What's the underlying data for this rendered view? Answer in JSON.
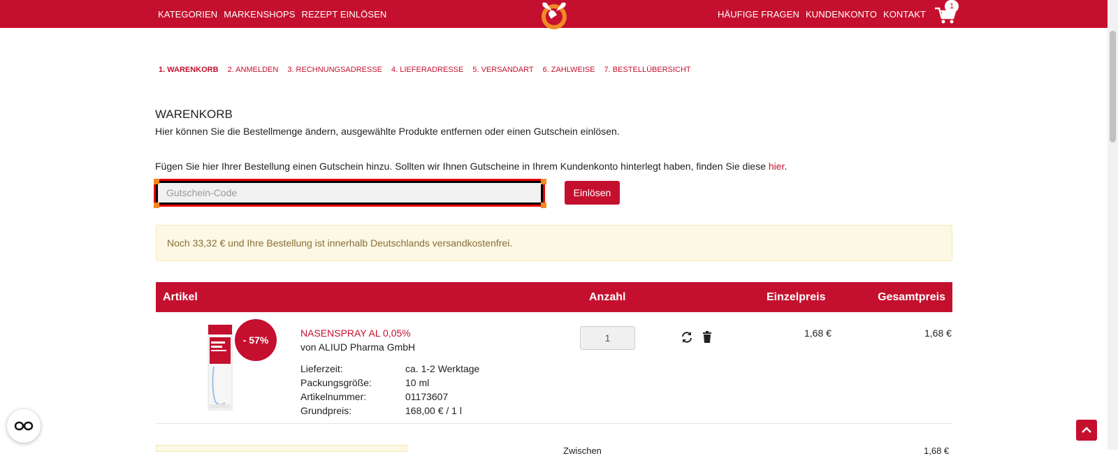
{
  "header": {
    "nav_left": [
      "KATEGORIEN",
      "MARKENSHOPS",
      "REZEPT EINLÖSEN"
    ],
    "nav_right": [
      "HÄUFIGE FRAGEN",
      "KUNDENKONTO",
      "KONTAKT"
    ],
    "cart_count": "1",
    "logo_icon": "pharmacy-logo-icon",
    "cart_icon": "cart-icon"
  },
  "steps": [
    "1. WARENKORB",
    "2. ANMELDEN",
    "3. RECHNUNGSADRESSE",
    "4. LIEFERADRESSE",
    "5. VERSANDART",
    "6. ZAHLWEISE",
    "7. BESTELLÜBERSICHT"
  ],
  "cart": {
    "title": "WARENKORB",
    "description": "Hier können Sie die Bestellmenge ändern, ausgewählte Produkte entfernen oder einen Gutschein einlösen.",
    "coupon_text": "Fügen Sie hier Ihrer Bestellung einen Gutschein hinzu. Sollten wir Ihnen Gutscheine in Ihrem Kundenkonto hinterlegt haben, finden Sie diese",
    "coupon_link": "hier",
    "coupon_suffix": ".",
    "coupon_placeholder": "Gutschein-Code",
    "redeem_label": "Einlösen",
    "notice": "Noch 33,32 € und Ihre Bestellung ist innerhalb Deutschlands versandkostenfrei."
  },
  "table": {
    "headers": {
      "article": "Artikel",
      "quantity": "Anzahl",
      "unit_price": "Einzelpreis",
      "total_price": "Gesamtpreis"
    }
  },
  "item": {
    "discount": "- 57%",
    "name": "NASENSPRAY AL 0,05%",
    "brand": "von ALIUD Pharma GmbH",
    "specs": [
      {
        "label": "Lieferzeit:",
        "value": "ca. 1-2 Werktage"
      },
      {
        "label": "Packungsgröße:",
        "value": "10 ml"
      },
      {
        "label": "Artikelnummer:",
        "value": "01173607"
      },
      {
        "label": "Grundpreis:",
        "value": "168,00 € / 1 l"
      }
    ],
    "quantity": "1",
    "unit_price": "1,68 €",
    "total_price": "1,68 €",
    "refresh_icon": "refresh-icon",
    "delete_icon": "trash-icon"
  },
  "footer_partial": {
    "text1": "Zwischen",
    "text2": "1,68 €"
  },
  "colors": {
    "brand": "#c4102e",
    "notice_bg": "#fcf8e3",
    "notice_text": "#8a6d3b"
  }
}
